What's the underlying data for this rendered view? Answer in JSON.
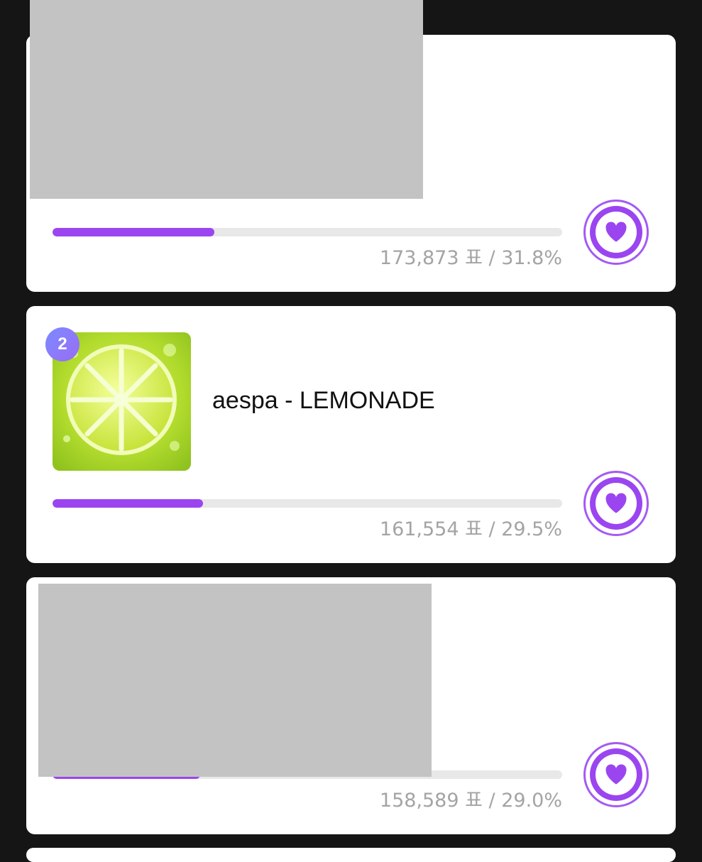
{
  "colors": {
    "background": "#151515",
    "card": "#ffffff",
    "accent": "#9b45f0",
    "track": "#e8e8e8",
    "stat_text": "#a4a4a4",
    "redaction": "#c3c3c3"
  },
  "entries": [
    {
      "visible_title": "",
      "rank": "",
      "vote_count": "173,873 표 / 31.8%",
      "progress_fraction": 0.318,
      "vote_icon": "heart-icon",
      "redacted": true
    },
    {
      "rank": "2",
      "title": "aespa - LEMONADE",
      "vote_count": "161,554 표 / 29.5%",
      "progress_fraction": 0.295,
      "album_art": "lemon-slice-artwork",
      "vote_icon": "heart-icon",
      "redacted": false
    },
    {
      "visible_title": "",
      "rank": "",
      "vote_count": "158,589 표 / 29.0%",
      "progress_fraction": 0.29,
      "vote_icon": "heart-icon",
      "redacted": true
    }
  ]
}
